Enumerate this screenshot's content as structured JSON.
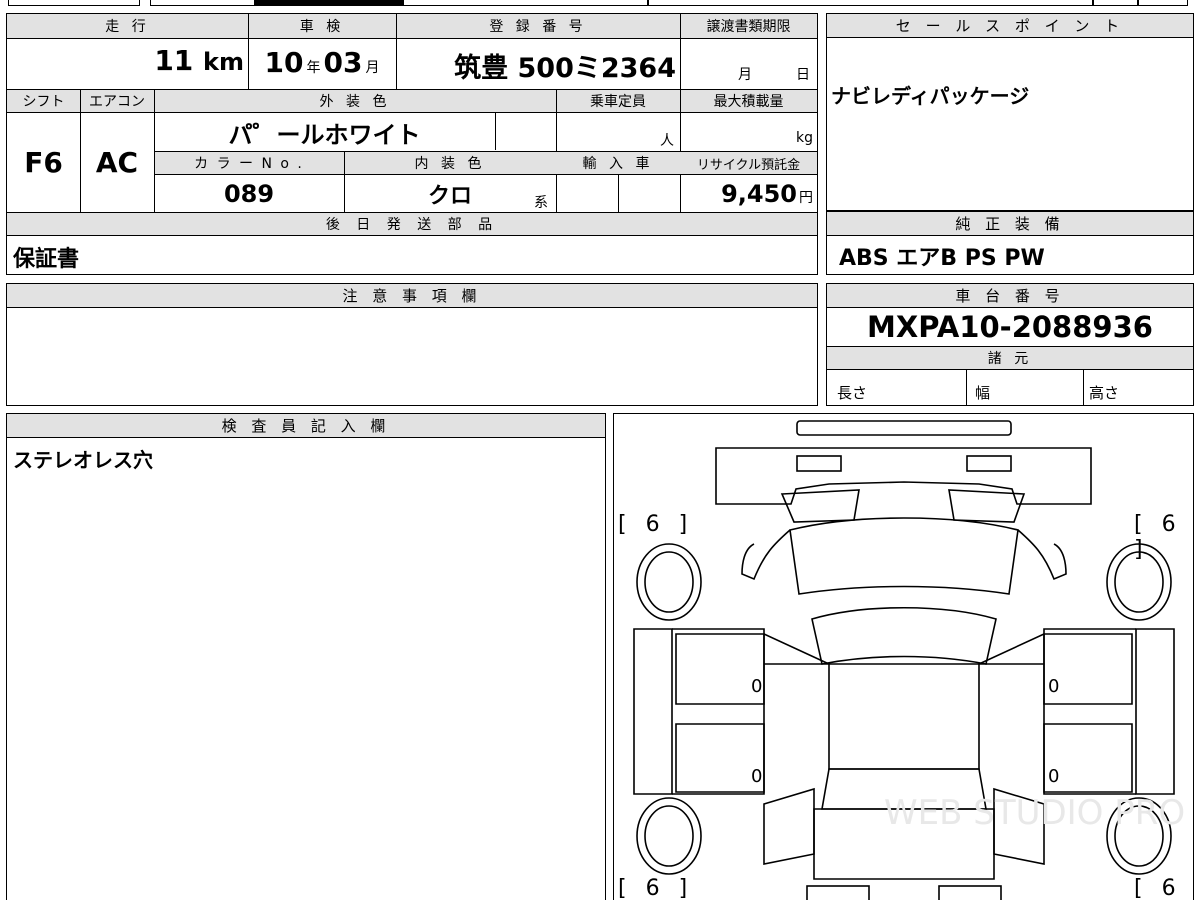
{
  "top_left_table": {
    "mileage": {
      "header": "走 行",
      "value": "11",
      "unit": "km"
    },
    "shaken": {
      "header": "車 検",
      "year": "10",
      "year_unit": "年",
      "month": "03",
      "month_unit": "月"
    },
    "registration": {
      "header": "登 録 番 号",
      "value": "筑豊 500ミ2364"
    },
    "transfer_deadline": {
      "header": "譲渡書類期限",
      "month_unit": "月",
      "day_unit": "日"
    },
    "shift": {
      "header": "シフト",
      "value": "F6"
    },
    "aircon": {
      "header": "エアコン",
      "value": "AC"
    },
    "exterior_color": {
      "header": "外 装 色",
      "value": "パ゜ールホワイト"
    },
    "capacity": {
      "header": "乗車定員",
      "unit": "人"
    },
    "max_load": {
      "header": "最大積載量",
      "unit": "kg"
    },
    "color_no": {
      "header": "カ ラ ー N o .",
      "value": "089"
    },
    "interior_color": {
      "header": "内 装 色",
      "value": "クロ",
      "suffix": "系"
    },
    "import": {
      "header": "輸 入 車"
    },
    "recycle": {
      "header": "リサイクル預託金",
      "value": "9,450",
      "unit": "円"
    },
    "later_parts": {
      "header": "後 日 発 送 部 品",
      "value": "保証書"
    }
  },
  "sales_point": {
    "header": "セ ー ル ス ポ イ ン ト",
    "value": "ナビレディパッケージ"
  },
  "standard_equipment": {
    "header": "純 正 装 備",
    "value": "ABS エアB PS PW"
  },
  "notes": {
    "header": "注 意 事 項 欄"
  },
  "chassis": {
    "header": "車 台 番 号",
    "value": "MXPA10-2088936"
  },
  "specs": {
    "header": "諸 元",
    "length": "長さ",
    "width": "幅",
    "height": "高さ"
  },
  "inspector": {
    "header": "検 査 員 記 入 欄",
    "value": "ステレオレス穴"
  },
  "diagram": {
    "tire_fl": "[ 6 ]",
    "tire_fr": "[ 6 ]",
    "tire_rl": "[ 6 ]",
    "tire_rr": "[ 6 ]",
    "door_fl": "0",
    "door_fr": "0",
    "door_rl": "0",
    "door_rr": "0",
    "watermark": "WEB STUDIO PRO"
  }
}
